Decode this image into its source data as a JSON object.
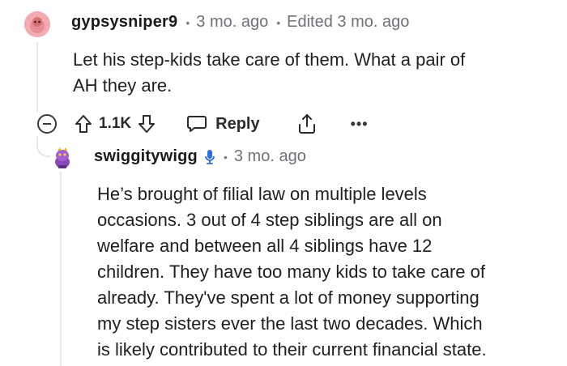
{
  "comment": {
    "username": "gypsysniper9",
    "time": "3 mo. ago",
    "edited": "Edited 3 mo. ago",
    "body_lines": [
      "Let his step-kids take care of them. What a pair of",
      "AH they are."
    ],
    "votes": "1.1K",
    "reply_label": "Reply",
    "more_label": "•••"
  },
  "reply": {
    "username": "swiggitywigg",
    "time": "3 mo. ago",
    "body_lines": [
      "He’s brought of filial law on multiple levels",
      "occasions. 3 out of 4 step siblings are all on",
      "welfare and between all 4 siblings have 12",
      "children. They have too many kids to take care of",
      "already. They've spent a lot of money supporting",
      "my step sisters ever the last two decades. Which",
      "is likely contributed to their current financial state."
    ]
  },
  "icons": {
    "collapse": "collapse-icon",
    "upvote": "upvote-icon",
    "downvote": "downvote-icon",
    "reply": "reply-bubble-icon",
    "share": "share-icon",
    "more": "more-icon",
    "mic": "microphone-icon"
  },
  "colors": {
    "text": "#1a1a1b",
    "muted": "#6f7177",
    "thread_line": "#e5e7ea",
    "mic_blue": "#2a6fdb"
  }
}
